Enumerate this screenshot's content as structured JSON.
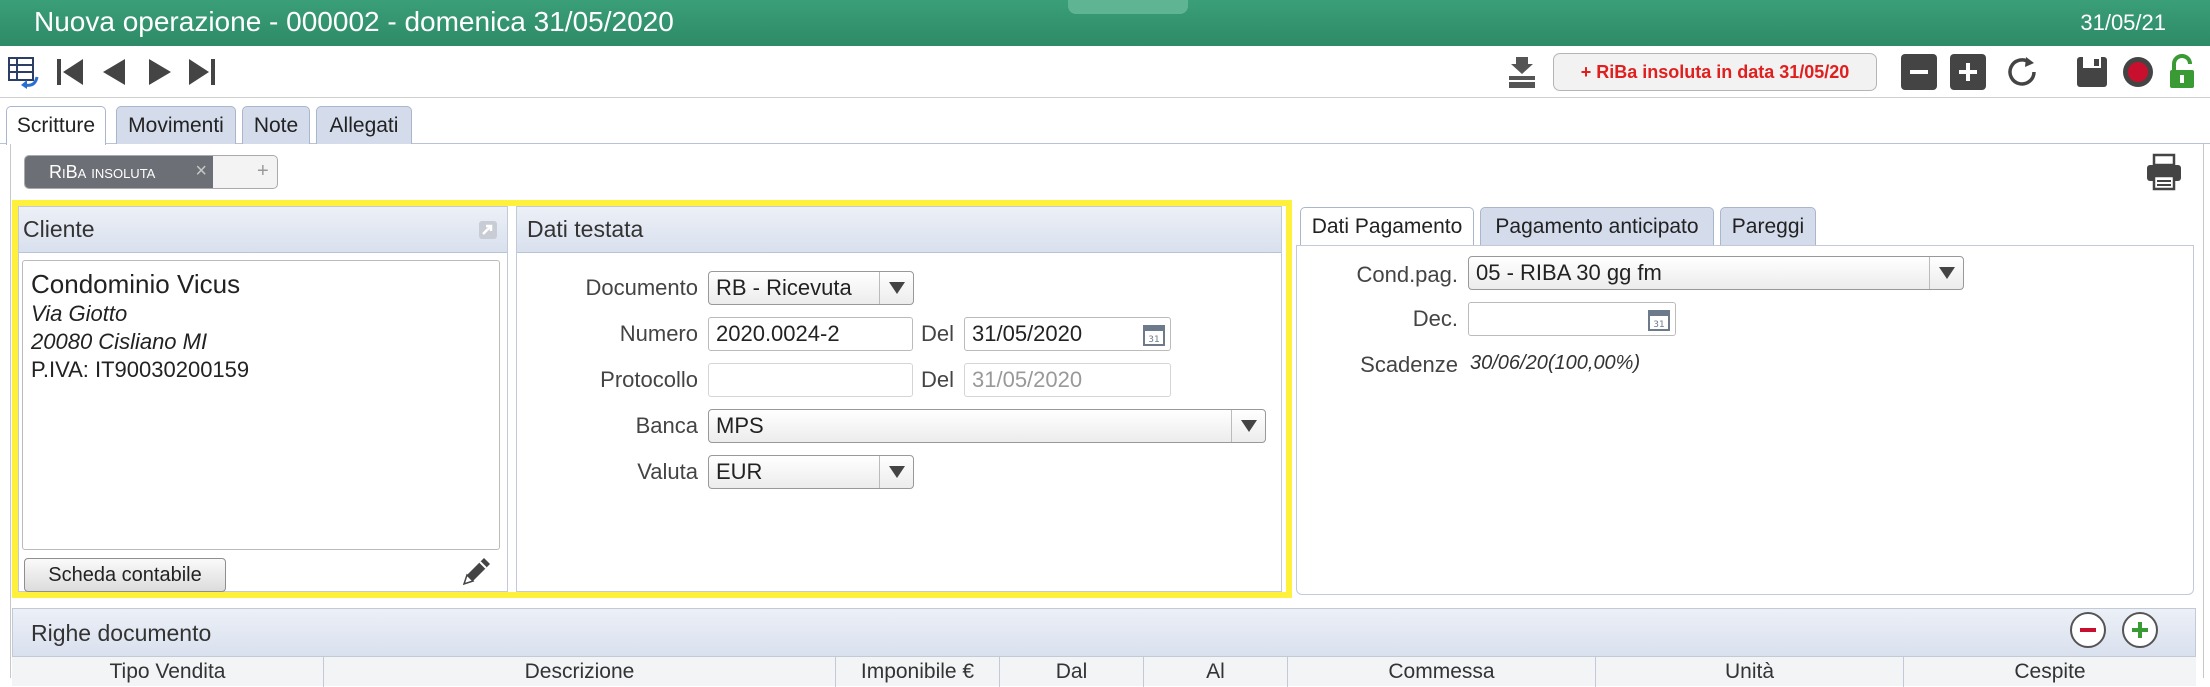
{
  "window": {
    "title": "Nuova operazione - 000002 - domenica 31/05/2020",
    "date": "31/05/21"
  },
  "toolbar": {
    "alert_label": "+ RiBa insoluta in data 31/05/20",
    "icons": [
      "table-undo-icon",
      "first-record-icon",
      "prev-record-icon",
      "next-record-icon",
      "last-record-icon",
      "inbox-tray-icon",
      "minus-icon",
      "plus-icon",
      "refresh-icon",
      "save-icon",
      "record-icon",
      "unlock-icon"
    ]
  },
  "tabs": [
    "Scritture",
    "Movimenti",
    "Note",
    "Allegati"
  ],
  "doc_pill": {
    "label": "RiBa insoluta",
    "close": "×",
    "add": "+"
  },
  "cliente": {
    "title": "Cliente",
    "name": "Condominio Vicus",
    "street": "Via Giotto",
    "city": "20080 Cisliano  MI",
    "piva": "P.IVA: IT90030200159",
    "scheda_button": "Scheda contabile"
  },
  "testata": {
    "title": "Dati testata",
    "documento_label": "Documento",
    "documento_value": "RB - Ricevuta",
    "numero_label": "Numero",
    "numero_value": "2020.0024-2",
    "del_label": "Del",
    "numero_date": "31/05/2020",
    "protocollo_label": "Protocollo",
    "protocollo_value": "",
    "protocollo_date": "31/05/2020",
    "banca_label": "Banca",
    "banca_value": "MPS",
    "valuta_label": "Valuta",
    "valuta_value": "EUR"
  },
  "pagamento": {
    "tabs": [
      "Dati Pagamento",
      "Pagamento anticipato",
      "Pareggi"
    ],
    "cond_label": "Cond.pag.",
    "cond_value": "05 - RIBA 30 gg fm",
    "dec_label": "Dec.",
    "dec_value": "",
    "scadenze_label": "Scadenze",
    "scadenze_value": "30/06/20(100,00%)"
  },
  "righe": {
    "title": "Righe documento",
    "columns": [
      "Tipo Vendita",
      "Descrizione",
      "Imponibile €",
      "Dal",
      "Al",
      "Commessa",
      "Unità",
      "Cespite"
    ]
  }
}
